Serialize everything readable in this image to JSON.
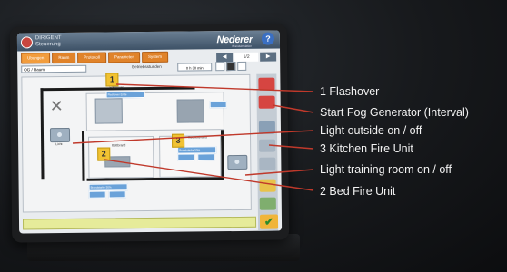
{
  "app": {
    "title_line1": "DIRIGENT",
    "title_line2": "Steuerung",
    "logo": "Nederer",
    "logo_sub": "Brandsimulation",
    "help_icon": "question-icon"
  },
  "tabs": [
    {
      "label": "Ubungen",
      "active": true
    },
    {
      "label": "Raum",
      "active": false
    },
    {
      "label": "Protokoll",
      "active": false
    },
    {
      "label": "Parameter",
      "active": false
    },
    {
      "label": "System",
      "active": false
    }
  ],
  "nav": {
    "prev": "◀",
    "page": "1/2",
    "next": "▶"
  },
  "toolbar": {
    "room_select": "OG / Raum",
    "schedule_label": "Betriebsstunden",
    "time_value": "0 h 30 min"
  },
  "plan": {
    "flashover_label": "Flashover",
    "flashover_field": "Flashover Ende",
    "bed_label": "Bettbrand",
    "bed_field": "Brandstarke 50%",
    "kitchen_label": "Kuchenbrand",
    "kitchen_field": "Brandstarke 50%",
    "light_label": "Licht",
    "bottom_field": "Brandstarke 50%"
  },
  "markers": [
    "1",
    "2",
    "3"
  ],
  "callouts": [
    "1 Flashover",
    "Start Fog Generator (Interval)",
    "Light outside on / off",
    "3 Kitchen Fire Unit",
    "Light training room on / off",
    "2 Bed Fire Unit"
  ],
  "colors": {
    "tab_orange": "#e0832a",
    "field_blue": "#6aa2d9",
    "marker_yellow": "#f1c232",
    "callout_red": "#c0392b"
  }
}
